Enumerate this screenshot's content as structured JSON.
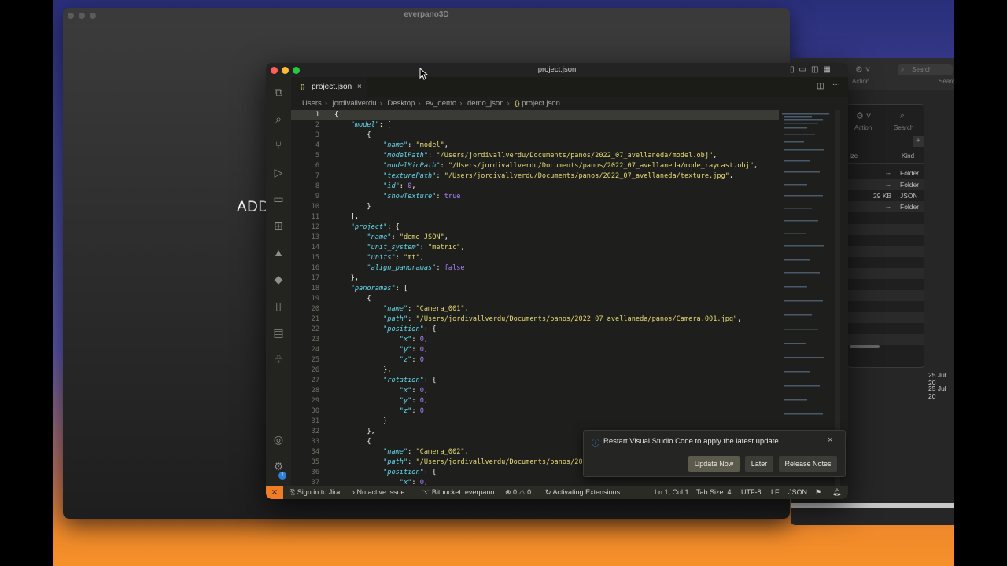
{
  "everpano": {
    "title": "everpano3D",
    "add_text": "ADD"
  },
  "finder": {
    "toolbar_action": "Action",
    "toolbar_search": "Search",
    "panel_action": "Action",
    "panel_search": "Search",
    "col_size": "ize",
    "col_kind": "Kind",
    "rows": [
      {
        "size": "--",
        "kind": "Folder"
      },
      {
        "size": "--",
        "kind": "Folder"
      },
      {
        "size": "29 KB",
        "kind": "JSON"
      },
      {
        "size": "--",
        "kind": "Folder"
      }
    ],
    "dates": [
      "25 Jul 20",
      "25 Jul 20"
    ]
  },
  "vscode": {
    "window_title": "project.json",
    "tab_label": "project.json",
    "breadcrumb": [
      "Users",
      "jordivallverdu",
      "Desktop",
      "ev_demo",
      "demo_json",
      "project.json"
    ],
    "code_lines": [
      "1",
      "2",
      "3",
      "4",
      "5",
      "6",
      "7",
      "8",
      "9",
      "10",
      "11",
      "12",
      "13",
      "14",
      "15",
      "16",
      "17",
      "18",
      "19",
      "20",
      "21",
      "22",
      "23",
      "24",
      "25",
      "26",
      "27",
      "28",
      "29",
      "30",
      "31",
      "32",
      "33",
      "34",
      "35",
      "36",
      "37"
    ],
    "notification": {
      "message": "Restart Visual Studio Code to apply the latest update.",
      "update_button": "Update Now",
      "later_button": "Later",
      "notes_button": "Release Notes"
    },
    "status": {
      "jira": "Sign in to Jira",
      "issue": "No active issue",
      "bitbucket": "Bitbucket: everpano:",
      "problems": "⊗ 0 ⚠ 0",
      "activity": "Activating Extensions...",
      "position": "Ln 1, Col 1",
      "tab_size": "Tab Size: 4",
      "encoding": "UTF-8",
      "eol": "LF",
      "language": "JSON"
    },
    "accent_color": "#f07c24"
  }
}
